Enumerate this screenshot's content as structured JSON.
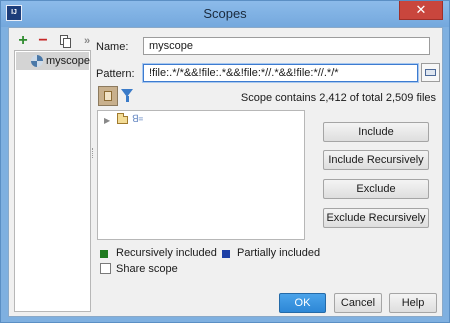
{
  "window": {
    "title": "Scopes",
    "close_label": "✕"
  },
  "toolbar": {
    "add": "+",
    "remove": "−",
    "more": "»"
  },
  "scopes": [
    {
      "label": "myscope"
    }
  ],
  "form": {
    "name_label": "Name:",
    "name_value": "myscope",
    "pattern_label": "Pattern:",
    "pattern_value": "!file:.*/*&&!file:.*&&!file:*//.*&&!file:*//.*/*"
  },
  "summary": "Scope contains 2,412 of total 2,509 files",
  "tree": {
    "root_label": "ꓭ꓿"
  },
  "side_buttons": {
    "include": "Include",
    "include_recursively": "Include Recursively",
    "exclude": "Exclude",
    "exclude_recursively": "Exclude Recursively"
  },
  "legend": {
    "recursive": "Recursively included",
    "partial": "Partially included",
    "recursive_color": "#1f7a1f",
    "partial_color": "#1d3fa6"
  },
  "share_scope": {
    "label": "Share scope",
    "checked": false
  },
  "footer": {
    "ok": "OK",
    "cancel": "Cancel",
    "help": "Help"
  }
}
